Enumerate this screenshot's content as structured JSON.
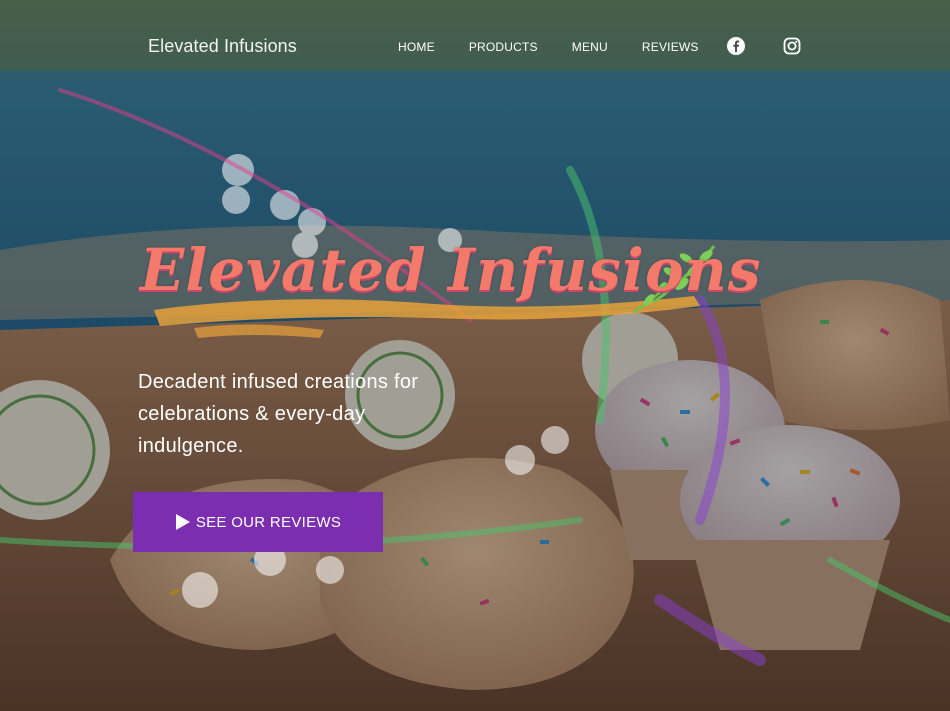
{
  "header": {
    "site_title": "Elevated Infusions",
    "nav": [
      {
        "label": "HOME"
      },
      {
        "label": "PRODUCTS"
      },
      {
        "label": "MENU"
      },
      {
        "label": "REVIEWS"
      }
    ],
    "social": [
      {
        "icon": "facebook-icon"
      },
      {
        "icon": "instagram-icon"
      }
    ]
  },
  "hero": {
    "logo_text": "Elevated Infusions",
    "tagline": "Decadent infused creations for celebrations & every-day indulgence.",
    "cta_label": "SEE OUR REVIEWS",
    "cta_icon": "play-icon"
  },
  "colors": {
    "accent": "#7b2fb0",
    "logo": "#f3796a",
    "pool": "#2f7fae"
  }
}
